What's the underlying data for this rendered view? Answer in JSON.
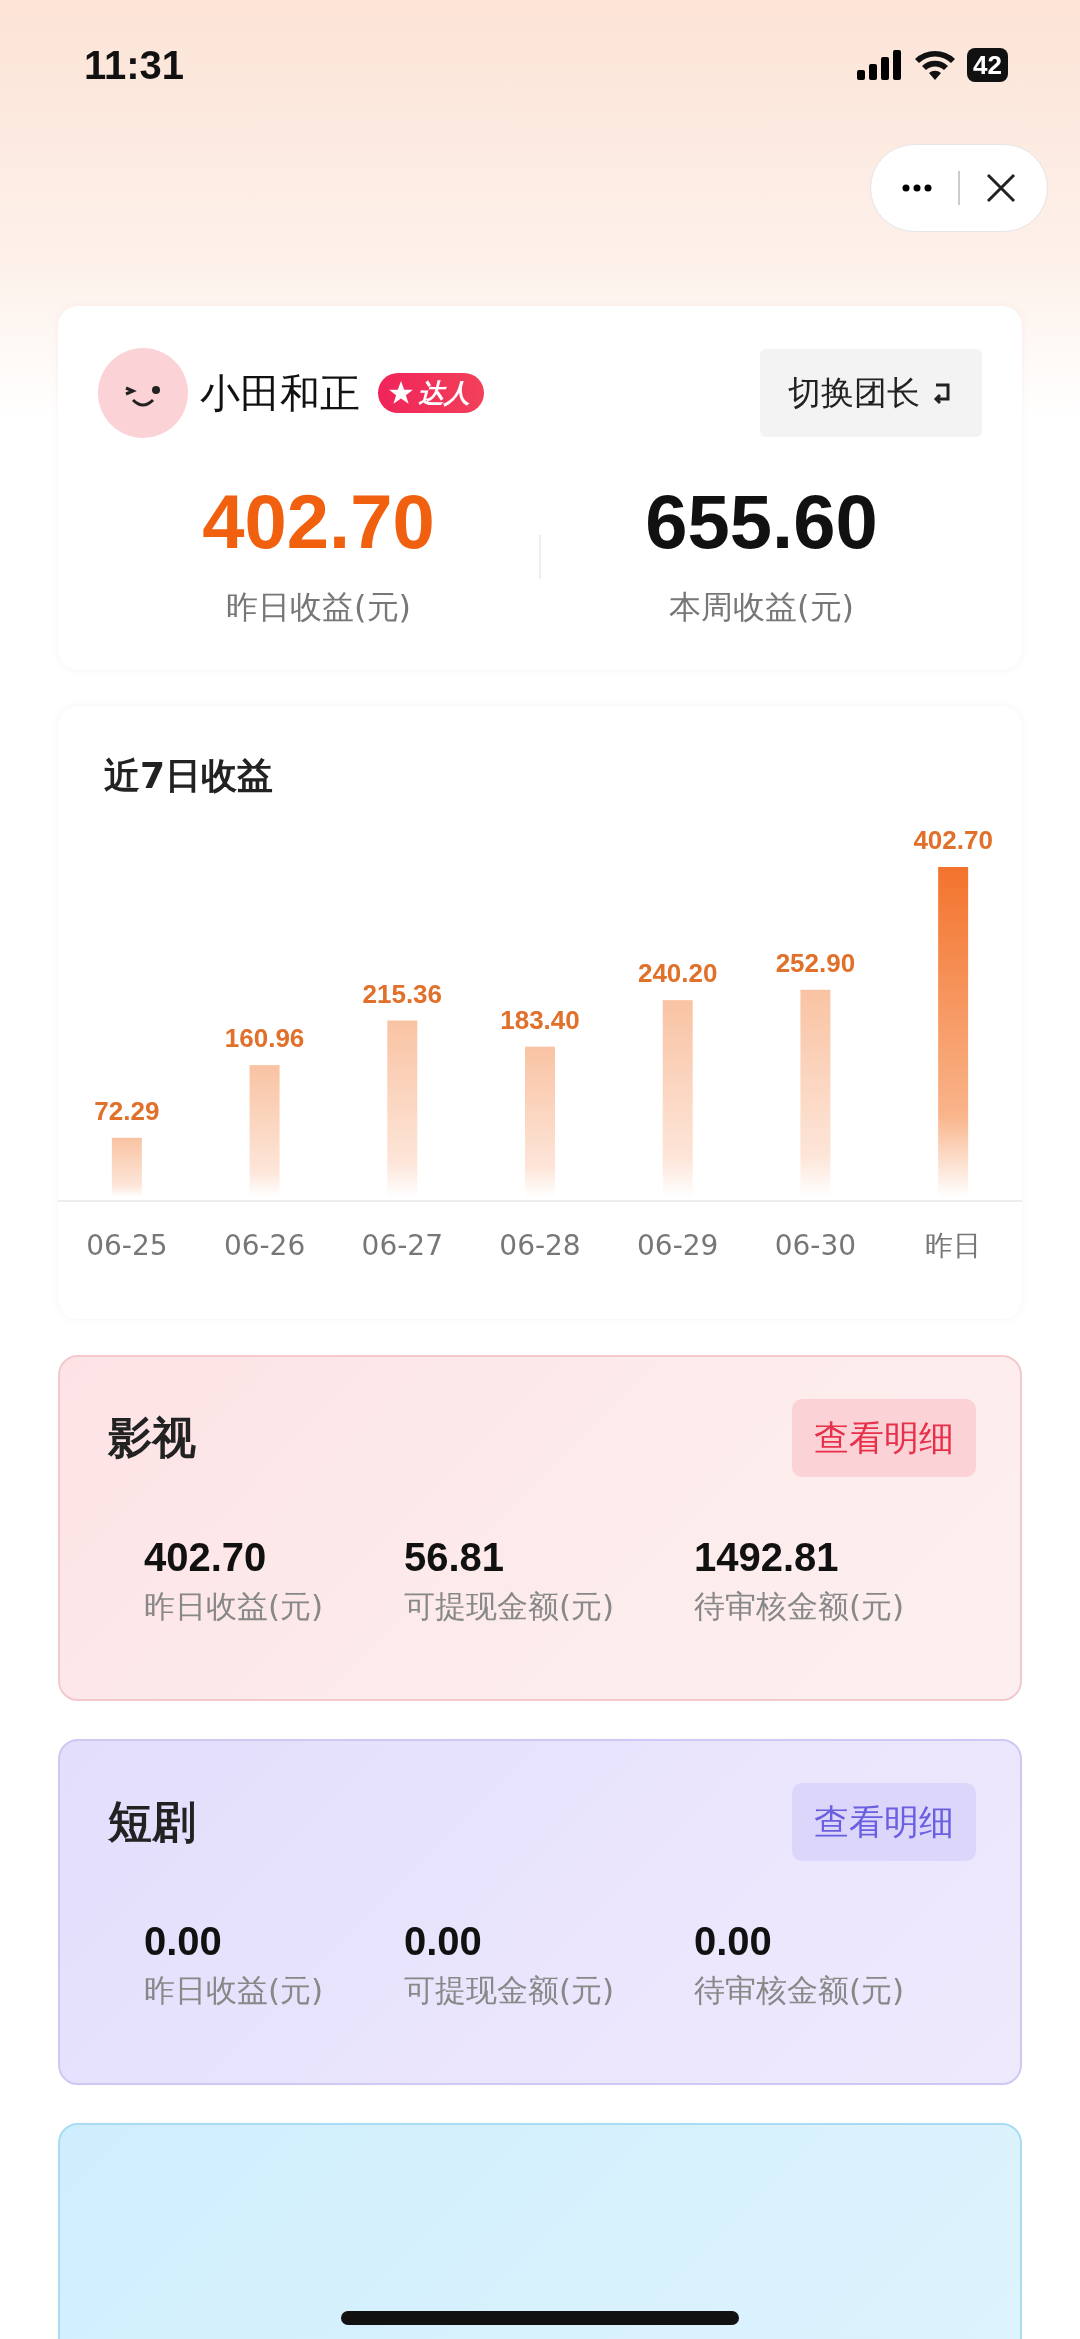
{
  "status_bar": {
    "time": "11:31",
    "battery": "42"
  },
  "profile": {
    "name": "小田和正",
    "badge": "达人",
    "switch_button": "切换团长"
  },
  "summary": [
    {
      "value": "402.70",
      "label": "昨日收益(元)",
      "color": "#f0600f"
    },
    {
      "value": "655.60",
      "label": "本周收益(元)",
      "color": "#111111"
    }
  ],
  "chart": {
    "title": "近7日收益",
    "chart_data": {
      "type": "bar",
      "categories": [
        "06-25",
        "06-26",
        "06-27",
        "06-28",
        "06-29",
        "06-30",
        "昨日"
      ],
      "values": [
        72.29,
        160.96,
        215.36,
        183.4,
        240.2,
        252.9,
        402.7
      ],
      "value_labels": [
        "72.29",
        "160.96",
        "215.36",
        "183.40",
        "240.20",
        "252.90",
        "402.70"
      ]
    }
  },
  "categories": [
    {
      "kind": "rose",
      "title": "影视",
      "button": "查看明细",
      "stats": [
        {
          "value": "402.70",
          "label": "昨日收益(元)"
        },
        {
          "value": "56.81",
          "label": "可提现金额(元)"
        },
        {
          "value": "1492.81",
          "label": "待审核金额(元)"
        }
      ]
    },
    {
      "kind": "violet",
      "title": "短剧",
      "button": "查看明细",
      "stats": [
        {
          "value": "0.00",
          "label": "昨日收益(元)"
        },
        {
          "value": "0.00",
          "label": "可提现金额(元)"
        },
        {
          "value": "0.00",
          "label": "待审核金额(元)"
        }
      ]
    },
    {
      "kind": "sky"
    }
  ]
}
